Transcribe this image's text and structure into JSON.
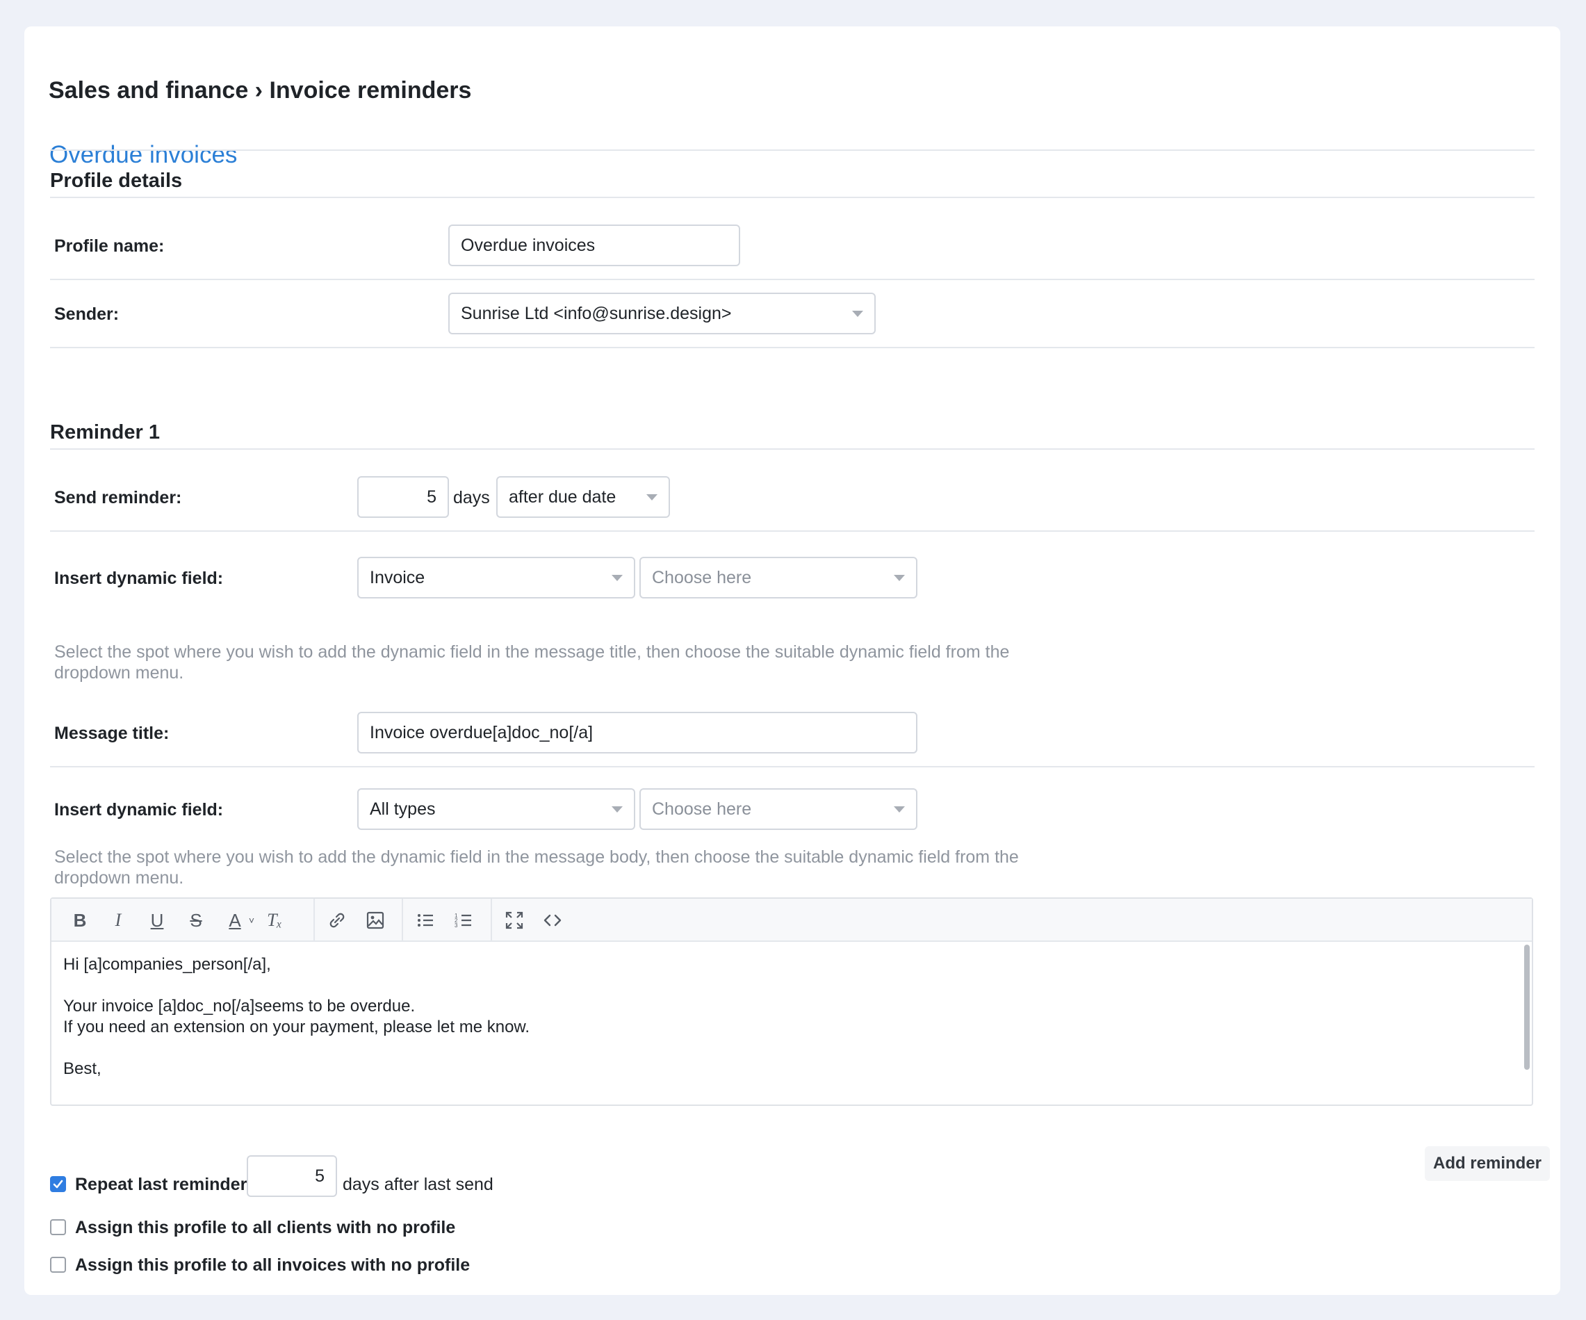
{
  "breadcrumb": "Sales and finance › Invoice reminders",
  "profile_title": "Overdue invoices",
  "profile_details": {
    "heading": "Profile details",
    "profile_name_label": "Profile name:",
    "profile_name_value": "Overdue invoices",
    "sender_label": "Sender:",
    "sender_value": "Sunrise Ltd <info@sunrise.design>"
  },
  "reminder": {
    "heading": "Reminder 1",
    "send_label": "Send reminder:",
    "days_value": "5",
    "days_unit": "days",
    "timing_value": "after due date",
    "dyn1_label": "Insert dynamic field:",
    "dyn1_category": "Invoice",
    "dyn1_field_placeholder": "Choose here",
    "dyn1_help": "Select the spot where you wish to add the dynamic field in the message title, then choose the suitable dynamic field from the dropdown menu.",
    "title_label": "Message title:",
    "title_value": "Invoice overdue[a]doc_no[/a]",
    "dyn2_label": "Insert dynamic field:",
    "dyn2_category": "All types",
    "dyn2_field_placeholder": "Choose here",
    "dyn2_help": "Select the spot where you wish to add the dynamic field in the message body, then choose the suitable dynamic field from the dropdown menu.",
    "body_lines": [
      "Hi [a]companies_person[/a],",
      "",
      "Your invoice [a]doc_no[/a]seems to be overdue.",
      "If you need an extension on your payment, please let me know.",
      "",
      "Best,"
    ]
  },
  "toolbar_icons": [
    "bold-icon",
    "italic-icon",
    "underline-icon",
    "strikethrough-icon",
    "text-color-icon",
    "clear-format-icon",
    "link-icon",
    "image-icon",
    "bullet-list-icon",
    "numbered-list-icon",
    "fullscreen-icon",
    "code-icon"
  ],
  "add_reminder_label": "Add reminder",
  "repeat": {
    "checked": true,
    "label": "Repeat last reminder",
    "days_value": "5",
    "suffix": "days after last send"
  },
  "assign_clients": {
    "checked": false,
    "label": "Assign this profile to all clients with no profile"
  },
  "assign_invoices": {
    "checked": false,
    "label": "Assign this profile to all invoices with no profile"
  },
  "colors": {
    "accent": "#2b7fd6",
    "checkbox": "#2f7de1",
    "background": "#eef1f8"
  }
}
